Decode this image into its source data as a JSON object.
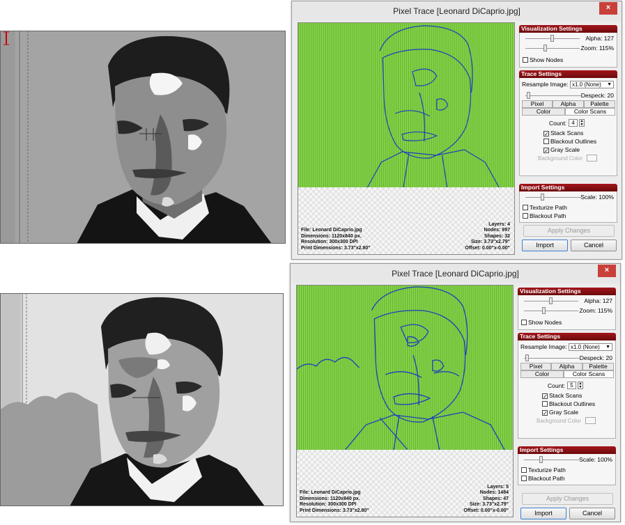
{
  "colors": {
    "trace_green": "#7fcf45",
    "trace_stroke": "#1a3fbf",
    "panel_header": "#8b1014",
    "close_red": "#c9403a"
  },
  "windows": [
    {
      "title": "Pixel Trace [Leonard DiCaprio.jpg]",
      "close_glyph": "×",
      "visualization": {
        "header": "Visualization Settings",
        "alpha_label": "Alpha: 127",
        "zoom_label": "Zoom: 115%",
        "show_nodes_label": "Show Nodes",
        "show_nodes_checked": false
      },
      "trace": {
        "header": "Trace Settings",
        "resample_label": "Resample Image:",
        "resample_value": "x1.0 (None)",
        "despeck_label": "Despeck: 20",
        "tabs_row1": [
          "Pixel",
          "Alpha",
          "Palette"
        ],
        "tabs_row2": [
          "Color",
          "Color Scans"
        ],
        "count_label": "Count:",
        "count_value": "4",
        "stack_scans": "Stack Scans",
        "stack_scans_checked": true,
        "blackout_outlines": "Blackout Outlines",
        "blackout_outlines_checked": false,
        "gray_scale": "Gray Scale",
        "gray_scale_checked": true,
        "background_color": "Background Color"
      },
      "import": {
        "header": "Import Settings",
        "scale_label": "Scale: 100%",
        "texturize_path": "Texturize Path",
        "blackout_path": "Blackout Path"
      },
      "buttons": {
        "apply": "Apply Changes",
        "import": "Import",
        "cancel": "Cancel"
      },
      "info": {
        "file": "File: Leonard DiCaprio.jpg",
        "dimensions": "Dimensions: 1120x840 px.",
        "resolution": "Resolution: 300x300 DPI",
        "print_dimensions": "Print Dimensions: 3.73\"x2.80\"",
        "layers": "Layers: 4",
        "nodes": "Nodes: 997",
        "shapes": "Shapes: 32",
        "size": "Size: 3.73\"x2.79\"",
        "offset": "Offset: 0.00\"x-0.00\""
      }
    },
    {
      "title": "Pixel Trace [Leonard DiCaprio.jpg]",
      "close_glyph": "×",
      "visualization": {
        "header": "Visualization Settings",
        "alpha_label": "Alpha: 127",
        "zoom_label": "Zoom: 115%",
        "show_nodes_label": "Show Nodes",
        "show_nodes_checked": false
      },
      "trace": {
        "header": "Trace Settings",
        "resample_label": "Resample Image:",
        "resample_value": "x1.0 (None)",
        "despeck_label": "Despeck: 20",
        "tabs_row1": [
          "Pixel",
          "Alpha",
          "Palette"
        ],
        "tabs_row2": [
          "Color",
          "Color Scans"
        ],
        "count_label": "Count:",
        "count_value": "5",
        "stack_scans": "Stack Scans",
        "stack_scans_checked": true,
        "blackout_outlines": "Blackout Outlines",
        "blackout_outlines_checked": false,
        "gray_scale": "Gray Scale",
        "gray_scale_checked": true,
        "background_color": "Background Color"
      },
      "import": {
        "header": "Import Settings",
        "scale_label": "Scale: 100%",
        "texturize_path": "Texturize Path",
        "blackout_path": "Blackout Path"
      },
      "buttons": {
        "apply": "Apply Changes",
        "import": "Import",
        "cancel": "Cancel"
      },
      "info": {
        "file": "File: Leonard DiCaprio.jpg",
        "dimensions": "Dimensions: 1120x840 px.",
        "resolution": "Resolution: 300x300 DPI",
        "print_dimensions": "Print Dimensions: 3.73\"x2.80\"",
        "layers": "Layers: 5",
        "nodes": "Nodes: 1484",
        "shapes": "Shapes: 47",
        "size": "Size: 3.73\"x2.79\"",
        "offset": "Offset: 0.00\"x-0.00\""
      }
    }
  ]
}
